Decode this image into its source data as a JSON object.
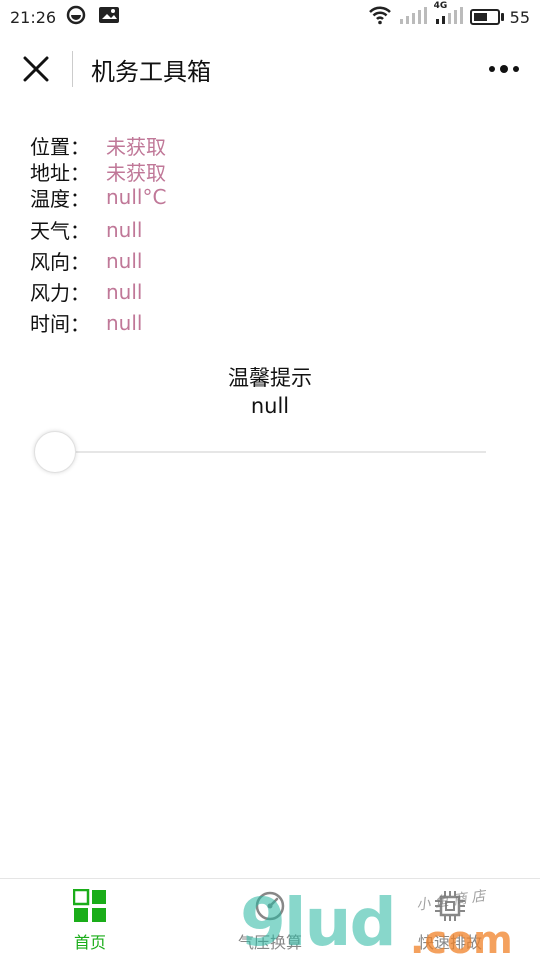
{
  "status_bar": {
    "time": "21:26",
    "battery": "55",
    "network": "4G",
    "battery_level_pct": 60
  },
  "title_bar": {
    "title": "机务工具箱"
  },
  "info": [
    {
      "label": "位置：",
      "value": "未获取"
    },
    {
      "label": "地址：",
      "value": "未获取"
    },
    {
      "label": "温度：",
      "value": "null°C"
    },
    {
      "label": "天气：",
      "value": "null"
    },
    {
      "label": "风向：",
      "value": "null"
    },
    {
      "label": "风力：",
      "value": "null"
    },
    {
      "label": "时间：",
      "value": "null"
    }
  ],
  "tip": {
    "title": "温馨提示",
    "text": "null"
  },
  "slider": {
    "value_fraction": 0
  },
  "tabs": [
    {
      "label": "首页",
      "icon": "grid-icon",
      "active": true
    },
    {
      "label": "气压换算",
      "icon": "pressure-icon",
      "active": false
    },
    {
      "label": "快速排故",
      "icon": "chip-icon",
      "active": false
    }
  ],
  "watermark": {
    "brand": "9lud",
    "suffix": ".com",
    "small": "小 鱼 商 店"
  },
  "colors": {
    "value_pink": "#c07898",
    "active_green": "#1aad19",
    "inactive_gray": "#888888"
  }
}
